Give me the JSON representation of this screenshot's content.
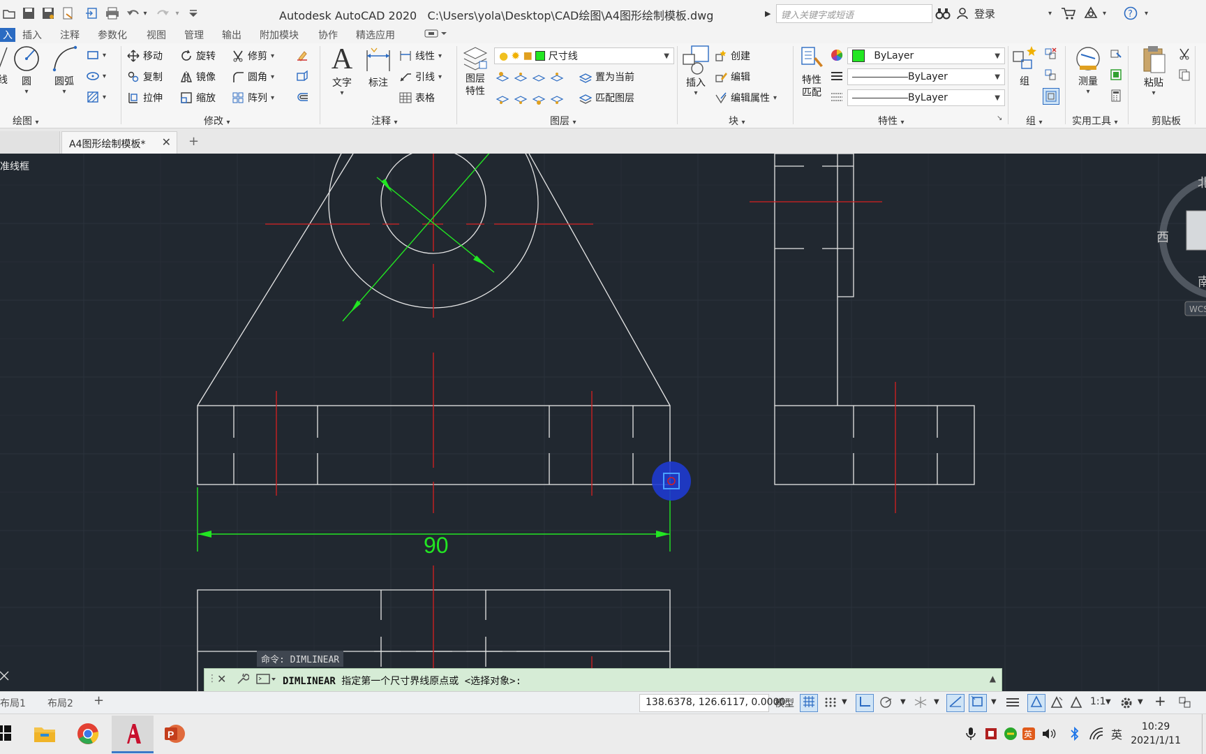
{
  "titlebar": {
    "app_name": "Autodesk AutoCAD 2020",
    "file_path": "C:\\Users\\yola\\Desktop\\CAD绘图\\A4图形绘制模板.dwg",
    "search_placeholder": "键入关键字或短语",
    "login_label": "登录"
  },
  "ribbon_tabs": [
    {
      "label": "入",
      "active": true
    },
    {
      "label": "插入"
    },
    {
      "label": "注释"
    },
    {
      "label": "参数化"
    },
    {
      "label": "视图"
    },
    {
      "label": "管理"
    },
    {
      "label": "输出"
    },
    {
      "label": "附加模块"
    },
    {
      "label": "协作"
    },
    {
      "label": "精选应用"
    }
  ],
  "panels": {
    "draw": {
      "title": "绘图",
      "line_partial": "线",
      "circle": "圆",
      "arc": "圆弧"
    },
    "modify": {
      "title": "修改",
      "move": "移动",
      "rotate": "旋转",
      "trim": "修剪",
      "copy": "复制",
      "mirror": "镜像",
      "fillet": "圆角",
      "stretch": "拉伸",
      "scale": "缩放",
      "array": "阵列"
    },
    "annotation": {
      "title": "注释",
      "text": "文字",
      "dimension": "标注",
      "linear": "线性",
      "leader": "引线",
      "table": "表格"
    },
    "layers": {
      "title": "图层",
      "layer_props_1": "图层",
      "layer_props_2": "特性",
      "current_layer": "尺寸线",
      "set_current": "置为当前",
      "match_layer": "匹配图层"
    },
    "block": {
      "title": "块",
      "insert": "插入",
      "create": "创建",
      "edit": "编辑",
      "edit_attributes": "编辑属性"
    },
    "properties": {
      "title": "特性",
      "match_1": "特性",
      "match_2": "匹配",
      "color": "ByLayer",
      "linetype": "ByLayer",
      "lineweight": "ByLayer"
    },
    "groups": {
      "title": "组",
      "group": "组"
    },
    "utilities": {
      "title": "实用工具",
      "measure": "测量"
    },
    "clipboard": {
      "title": "剪贴板",
      "paste": "粘贴"
    }
  },
  "document": {
    "tab_title": "A4图形绘制模板*",
    "viewport_label": "准线框",
    "dimension_text": "90"
  },
  "viewcube": {
    "north": "北",
    "west": "西",
    "south": "南",
    "wcs": "WCS"
  },
  "command": {
    "history": "命令:  DIMLINEAR",
    "prompt_cmd": "DIMLINEAR",
    "prompt_text": "指定第一个尺寸界线原点或 <选择对象>:"
  },
  "layout_tabs": [
    "布局1",
    "布局2"
  ],
  "status": {
    "coords": "138.6378, 126.6117, 0.0000",
    "model": "模型",
    "scale": "1:1"
  },
  "taskbar": {
    "time": "10:29",
    "date": "2021/1/11",
    "ime": "英"
  },
  "colors": {
    "canvas_bg": "#212830",
    "geometry": "#e6e6e6",
    "center_line": "#d62020",
    "dimension": "#22e622",
    "cmdline_bg": "#d6ecd6",
    "accent": "#2b6bc2"
  }
}
